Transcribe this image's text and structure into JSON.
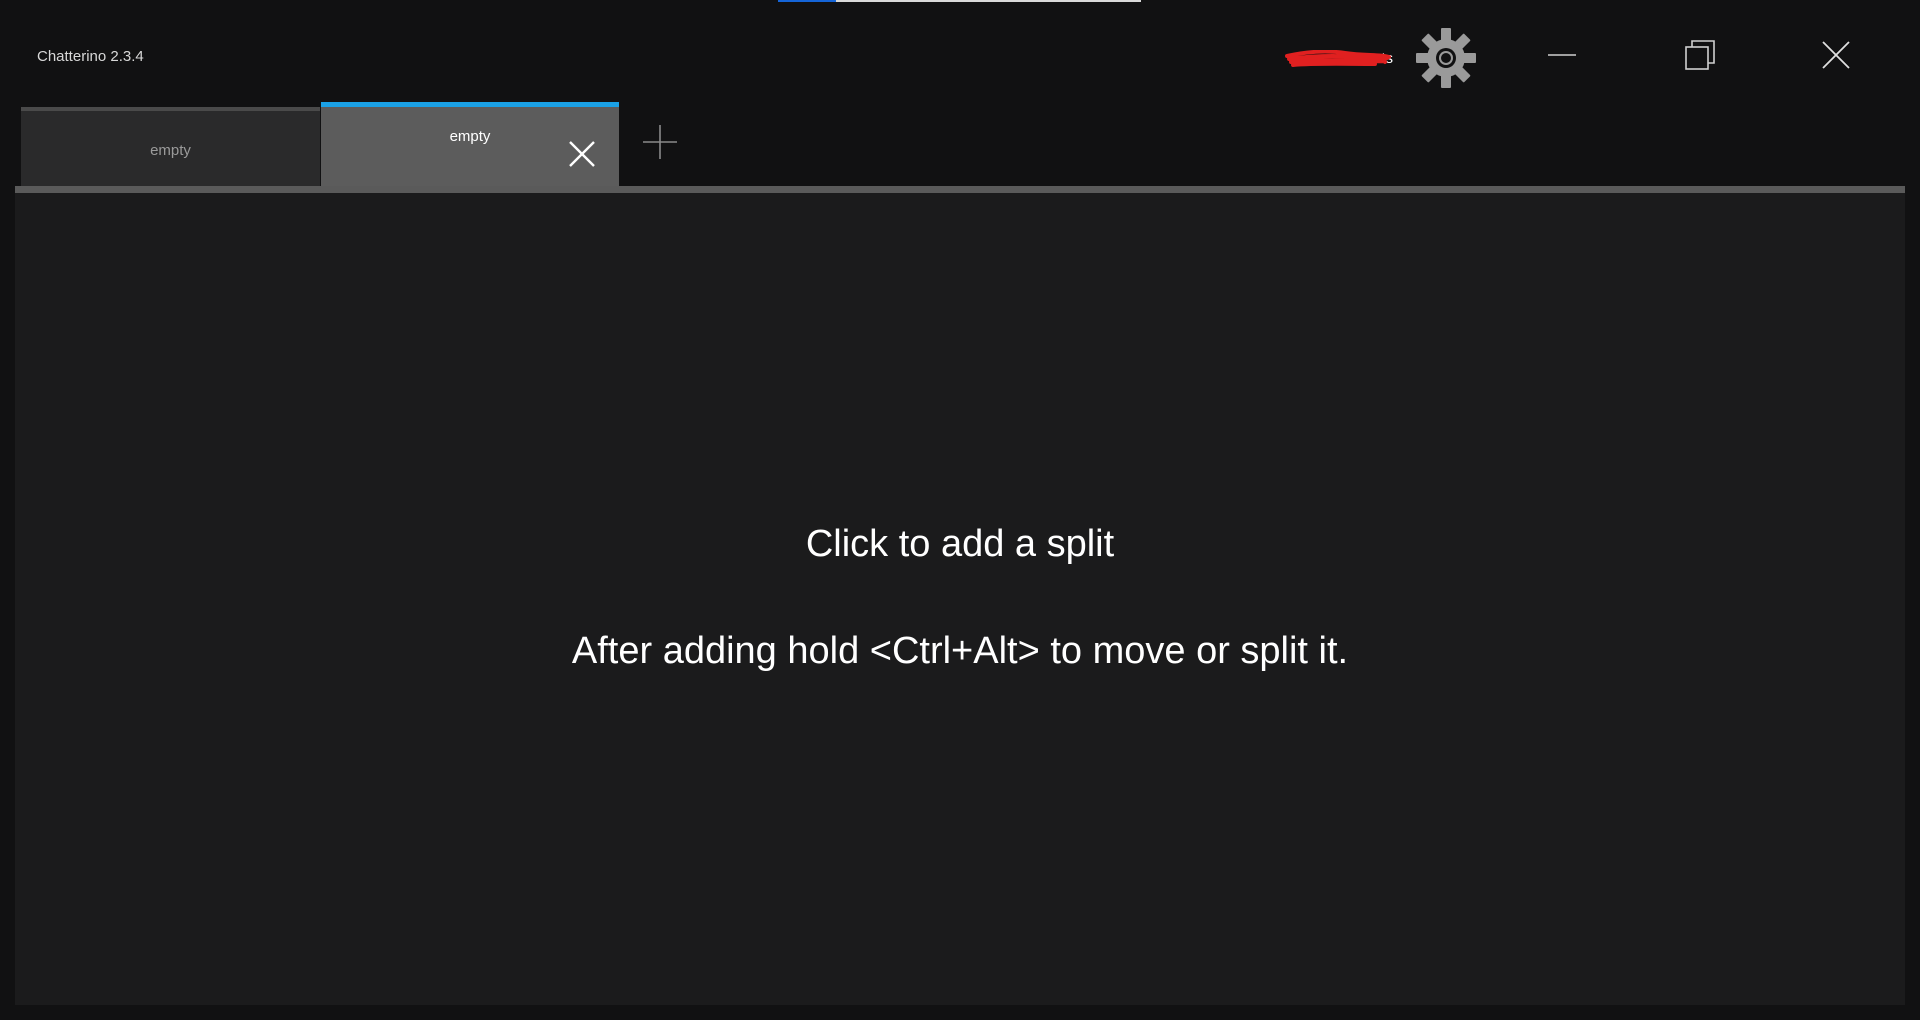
{
  "window": {
    "title": "Chatterino 2.3.4",
    "user_label": "ts",
    "progress_fraction": 0.16
  },
  "icons": {
    "settings": "gear-icon",
    "minimize": "minimize-icon",
    "maximize": "restore-icon",
    "close": "close-icon",
    "tab_close": "close-icon",
    "add_tab": "plus-icon"
  },
  "tabs": [
    {
      "label": "empty",
      "selected": false
    },
    {
      "label": "empty",
      "selected": true
    }
  ],
  "split": {
    "hint_primary": "Click to add a split",
    "hint_secondary": "After adding hold <Ctrl+Alt> to move or split it."
  },
  "colors": {
    "accent": "#1aa1e6",
    "progress": "#1565d8",
    "background": "#1b1b1c",
    "scribble": "#e02020"
  }
}
